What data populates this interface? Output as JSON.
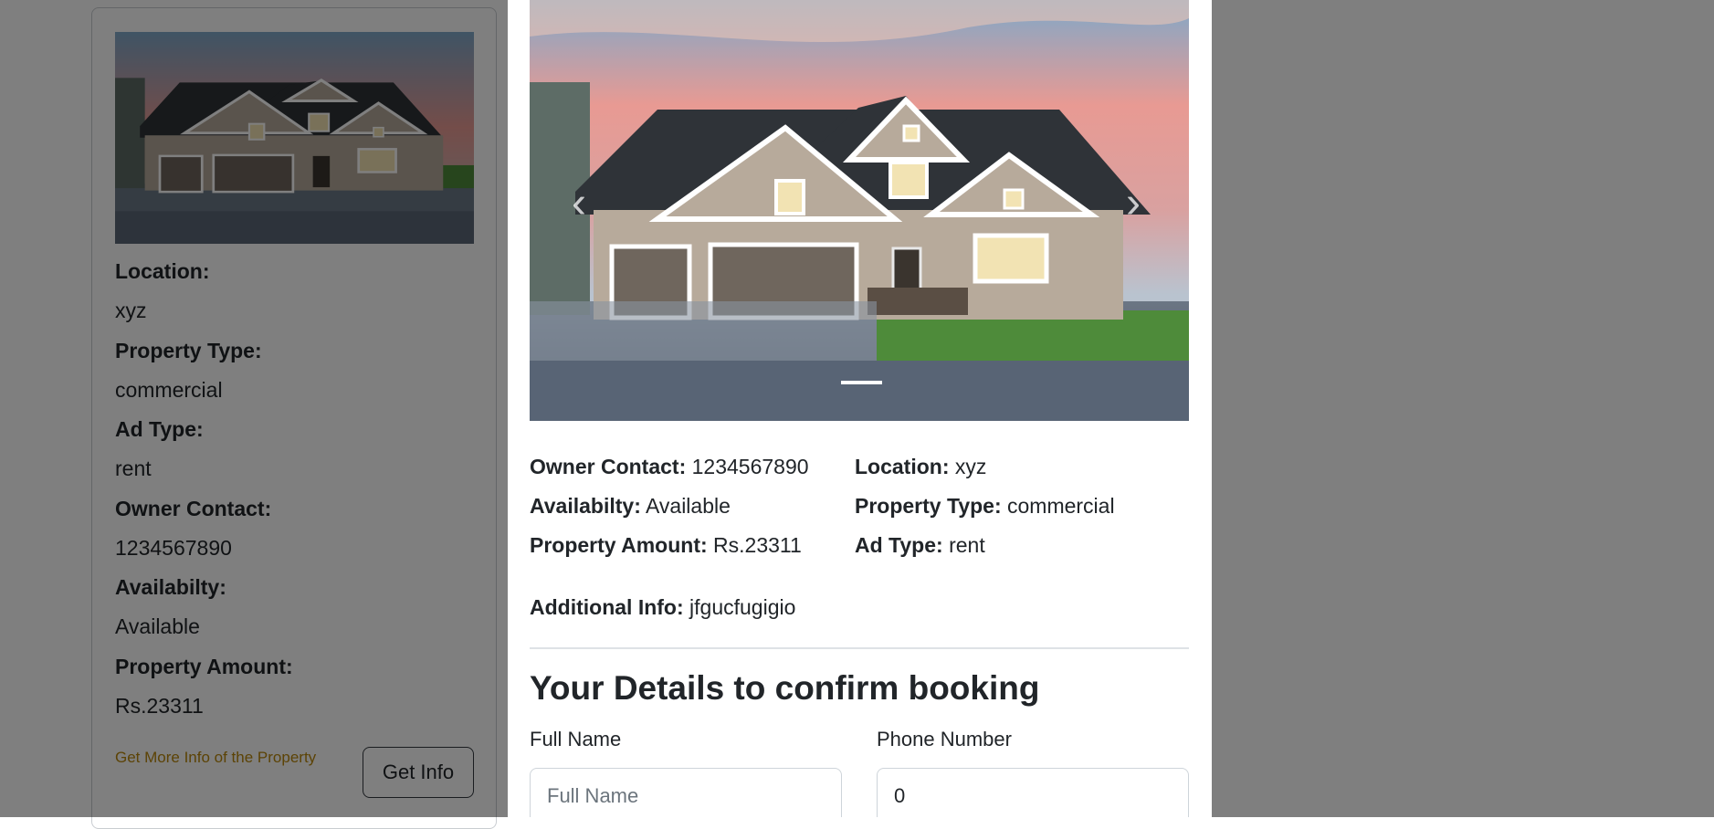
{
  "card": {
    "items": [
      {
        "label": "Location:",
        "value": "xyz"
      },
      {
        "label": "Property Type:",
        "value": "commercial"
      },
      {
        "label": "Ad Type:",
        "value": "rent"
      },
      {
        "label": "Owner Contact:",
        "value": "1234567890"
      },
      {
        "label": "Availabilty:",
        "value": "Available"
      },
      {
        "label": "Property Amount:",
        "value": "Rs.23311"
      }
    ],
    "more_link": "Get More Info of the Property",
    "get_info_button": "Get Info"
  },
  "modal": {
    "carousel": {
      "prev_icon": "chevron-left-icon",
      "next_icon": "chevron-right-icon",
      "slide_count": 1,
      "active_slide": 1
    },
    "details": {
      "owner_contact_label": "Owner Contact:",
      "owner_contact_value": "1234567890",
      "availability_label": "Availabilty:",
      "availability_value": "Available",
      "amount_label": "Property Amount:",
      "amount_value": "Rs.23311",
      "location_label": "Location:",
      "location_value": "xyz",
      "property_type_label": "Property Type:",
      "property_type_value": "commercial",
      "ad_type_label": "Ad Type:",
      "ad_type_value": "rent",
      "additional_label": "Additional Info:",
      "additional_value": "jfgucfugigio"
    },
    "form": {
      "title": "Your Details to confirm booking",
      "full_name_label": "Full Name",
      "full_name_placeholder": "Full Name",
      "full_name_value": "",
      "phone_label": "Phone Number",
      "phone_value": "0"
    }
  },
  "colors": {
    "overlay": "#000000",
    "link": "#b8860b",
    "text": "#212529",
    "divider": "#dee2e6"
  }
}
